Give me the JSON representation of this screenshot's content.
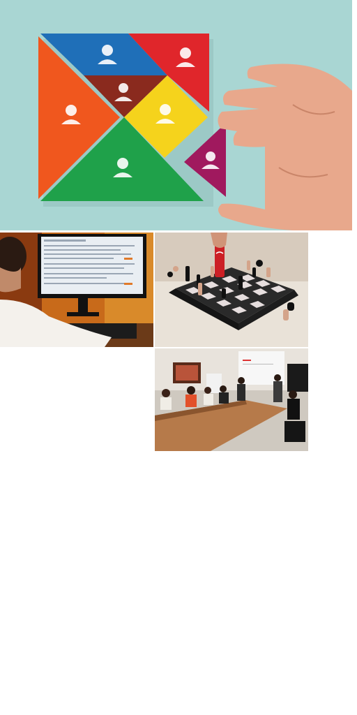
{
  "photos": [
    {
      "id": "hero",
      "subject": "tangram-puzzle-with-person-icons"
    },
    {
      "id": "computer",
      "subject": "person-at-computer-monitor"
    },
    {
      "id": "chess",
      "subject": "chessboard-with-red-can-piece"
    },
    {
      "id": "meeting",
      "subject": "conference-room-presentation"
    }
  ],
  "colors": {
    "teal_background": "#a9d6d3",
    "tangram_blue": "#1f6fb8",
    "tangram_red": "#e0262b",
    "tangram_orange": "#f0571e",
    "tangram_brown": "#8a2a1e",
    "tangram_yellow": "#f5d31c",
    "tangram_green": "#1fa14a",
    "tangram_magenta": "#a0195e",
    "skin": "#e8a88c",
    "office_orange": "#c86a1a",
    "chess_dark": "#1c1c1c",
    "chess_light": "#e6dede",
    "meeting_wood": "#b67a4a"
  }
}
